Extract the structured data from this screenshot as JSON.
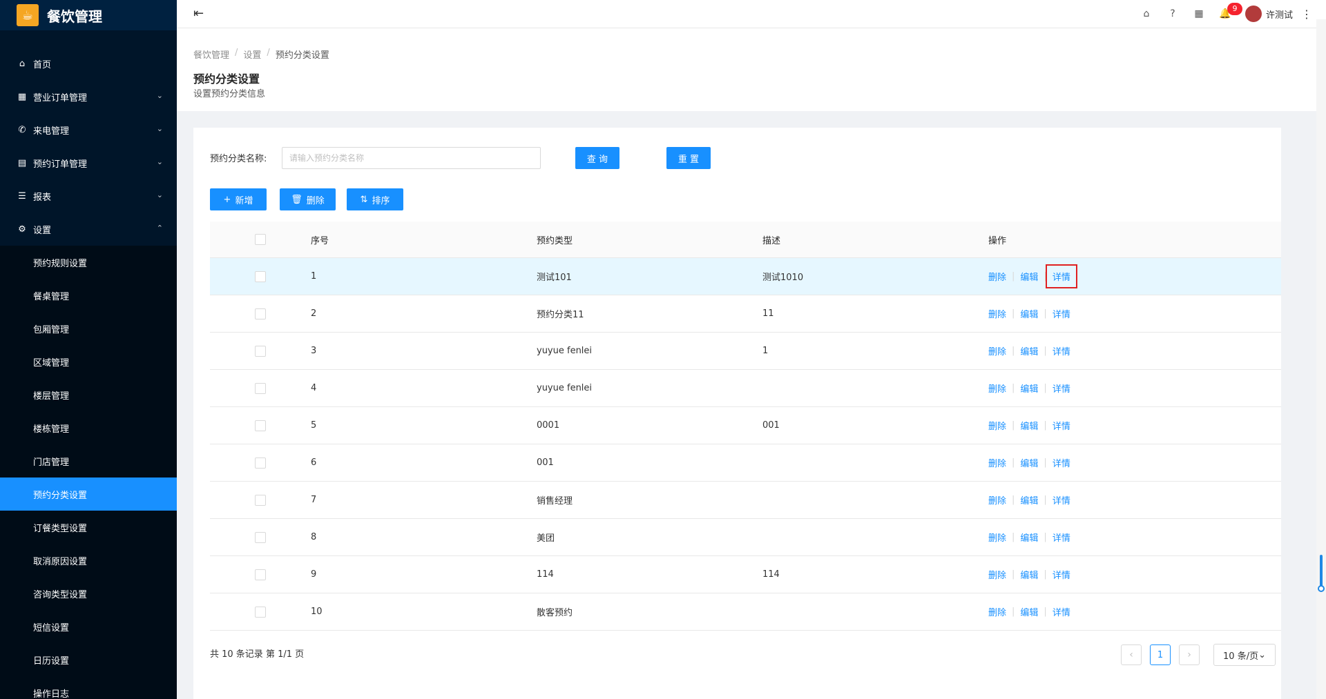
{
  "app": {
    "name": "餐饮管理"
  },
  "sidebar": {
    "items": [
      {
        "label": "首页",
        "icon": "home-icon"
      },
      {
        "label": "营业订单管理",
        "icon": "order-icon"
      },
      {
        "label": "来电管理",
        "icon": "phone-icon"
      },
      {
        "label": "预约订单管理",
        "icon": "list-icon"
      },
      {
        "label": "报表",
        "icon": "menu-icon"
      },
      {
        "label": "设置",
        "icon": "gear-icon"
      }
    ],
    "settings_sub": [
      "预约规则设置",
      "餐桌管理",
      "包厢管理",
      "区域管理",
      "楼层管理",
      "楼栋管理",
      "门店管理",
      "预约分类设置",
      "订餐类型设置",
      "取消原因设置",
      "咨询类型设置",
      "短信设置",
      "日历设置",
      "操作日志"
    ],
    "active_sub": "预约分类设置"
  },
  "topbar": {
    "notification_count": "9",
    "username": "许测试"
  },
  "breadcrumb": [
    "餐饮管理",
    "设置",
    "预约分类设置"
  ],
  "page": {
    "title": "预约分类设置",
    "subtitle": "设置预约分类信息"
  },
  "search": {
    "label": "预约分类名称:",
    "placeholder": "请输入预约分类名称",
    "query_label": "查 询",
    "reset_label": "重 置"
  },
  "toolbar": {
    "add_label": "新增",
    "delete_label": "删除",
    "sort_label": "排序"
  },
  "table": {
    "headers": {
      "no": "序号",
      "type": "预约类型",
      "desc": "描述",
      "op": "操作"
    },
    "op_labels": {
      "delete": "删除",
      "edit": "编辑",
      "detail": "详情"
    },
    "rows": [
      {
        "no": "1",
        "type": "测试101",
        "desc": "测试1010"
      },
      {
        "no": "2",
        "type": "预约分类11",
        "desc": "11"
      },
      {
        "no": "3",
        "type": "yuyue fenlei",
        "desc": "1"
      },
      {
        "no": "4",
        "type": "yuyue fenlei",
        "desc": ""
      },
      {
        "no": "5",
        "type": "0001",
        "desc": "001"
      },
      {
        "no": "6",
        "type": "001",
        "desc": ""
      },
      {
        "no": "7",
        "type": "销售经理",
        "desc": ""
      },
      {
        "no": "8",
        "type": "美团",
        "desc": ""
      },
      {
        "no": "9",
        "type": "114",
        "desc": "114"
      },
      {
        "no": "10",
        "type": "散客预约",
        "desc": ""
      }
    ]
  },
  "pagination": {
    "summary": "共 10 条记录 第 1/1 页",
    "current": "1",
    "page_size": "10 条/页"
  },
  "colors": {
    "primary": "#1890ff",
    "sidebar_bg": "#001529",
    "highlight_row": "#e6f7ff",
    "annotation_red": "#e02020"
  }
}
